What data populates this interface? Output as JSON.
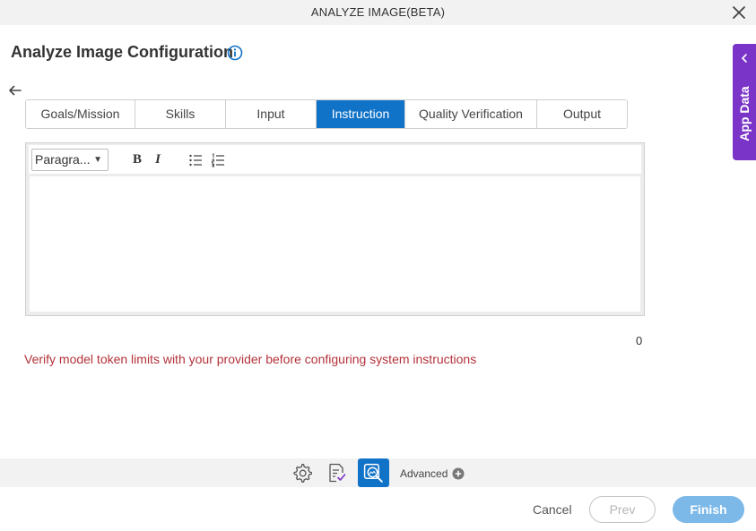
{
  "window": {
    "title": "ANALYZE IMAGE(BETA)"
  },
  "page": {
    "heading": "Analyze Image Configuration"
  },
  "tabs": [
    {
      "label": "Goals/Mission"
    },
    {
      "label": "Skills"
    },
    {
      "label": "Input"
    },
    {
      "label": "Instruction",
      "active": true
    },
    {
      "label": "Quality Verification"
    },
    {
      "label": "Output"
    }
  ],
  "editor": {
    "paragraph_select": "Paragra...",
    "bold_label": "B",
    "italic_label": "I",
    "content": "",
    "char_count": "0"
  },
  "warning_text": "Verify model token limits with your provider before configuring system instructions",
  "bottom_bar": {
    "advanced_label": "Advanced"
  },
  "footer": {
    "cancel_label": "Cancel",
    "prev_label": "Prev",
    "finish_label": "Finish"
  },
  "side_panel": {
    "label": "App Data"
  },
  "colors": {
    "accent": "#1173c8",
    "side_panel": "#7a35c8",
    "warning": "#b3323a",
    "finish_button": "#7cb8e8"
  },
  "icons": {
    "close": "close-icon",
    "info": "info-icon",
    "back": "back-arrow-icon",
    "settings": "gear-icon",
    "document": "document-check-icon",
    "analyze": "image-search-icon",
    "add": "plus-circle-icon",
    "chevron": "chevron-left-icon"
  }
}
